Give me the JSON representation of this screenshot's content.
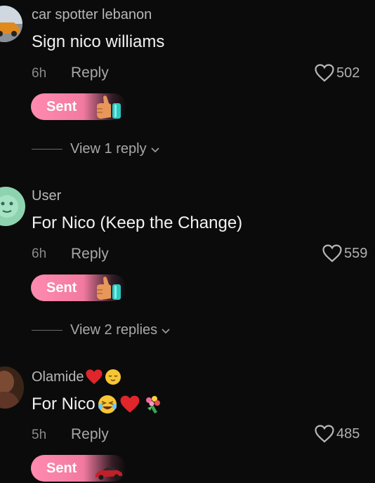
{
  "comments": [
    {
      "username": "car spotter lebanon",
      "text": "Sign nico williams",
      "time": "6h",
      "reply_label": "Reply",
      "likes": "502",
      "sent_label": "Sent",
      "view_replies": "View 1 reply"
    },
    {
      "username": "User",
      "text": "For Nico (Keep the Change)",
      "time": "6h",
      "reply_label": "Reply",
      "likes": "559",
      "sent_label": "Sent",
      "view_replies": "View 2 replies"
    },
    {
      "username": "Olamide",
      "text": "For Nico",
      "time": "5h",
      "reply_label": "Reply",
      "likes": "485",
      "sent_label": "Sent"
    }
  ],
  "colors": {
    "background": "#0b0b0b",
    "sent_pill": "#f27aa0",
    "heart_emoji": "#e0252b"
  },
  "icons": {
    "like": "heart-outline-icon",
    "expand": "chevron-down-icon",
    "gift_thumbs": "thumbs-up-gift-icon",
    "gift_car": "sports-car-gift-icon"
  }
}
